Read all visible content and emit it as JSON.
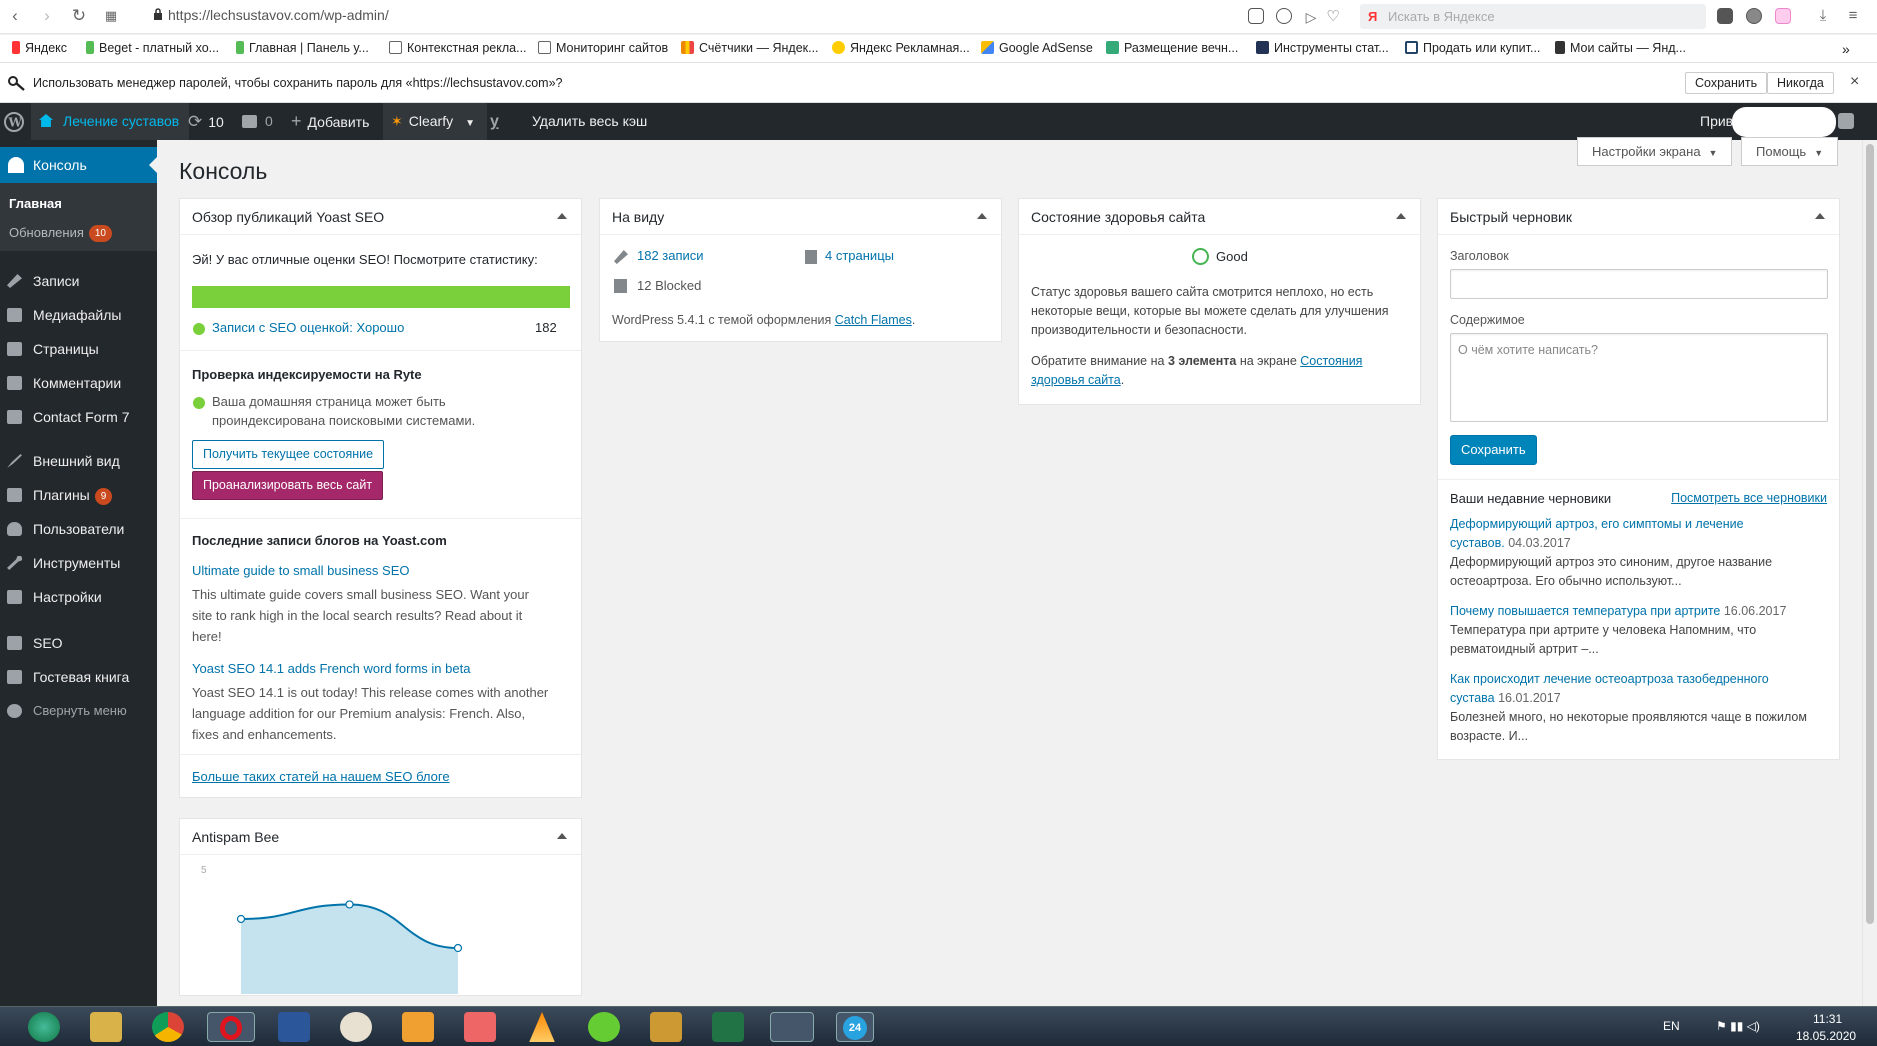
{
  "browser": {
    "url": "https://lechsustavov.com/wp-admin/",
    "search_placeholder": "Искать в Яндексе",
    "search_logo": "Я",
    "bookmarks": [
      {
        "label": "Яндекс",
        "color": "#f33"
      },
      {
        "label": "Beget - платный хо...",
        "color": "#5b5"
      },
      {
        "label": "Главная | Панель у...",
        "color": "#5b5"
      },
      {
        "label": "Контекстная рекла...",
        "color": "#888"
      },
      {
        "label": "Мониторинг сайтов",
        "color": "#888"
      },
      {
        "label": "Счётчики — Яндек...",
        "color": "#e80"
      },
      {
        "label": "Яндекс Рекламная...",
        "color": "#fc0"
      },
      {
        "label": "Google AdSense",
        "color": "#fbbc05"
      },
      {
        "label": "Размещение вечн...",
        "color": "#3a7"
      },
      {
        "label": "Инструменты стат...",
        "color": "#235"
      },
      {
        "label": "Продать или купит...",
        "color": "#246"
      },
      {
        "label": "Мои сайты — Янд...",
        "color": "#333"
      }
    ],
    "password_prompt": "Использовать менеджер паролей, чтобы сохранить пароль для «https://lechsustavov.com»?",
    "save_label": "Сохранить",
    "never_label": "Никогда",
    "close_glyph": "×"
  },
  "adminbar": {
    "site_name": "Лечение суставов",
    "updates_count": "10",
    "comments_count": "0",
    "add_label": "Добавить",
    "clearfy_label": "Clearfy",
    "clear_cache_label": "Удалить весь кэш",
    "greeting": "Прив"
  },
  "sidebar": {
    "console": "Консоль",
    "home": "Главная",
    "updates": "Обновления",
    "updates_badge": "10",
    "items": [
      {
        "label": "Записи"
      },
      {
        "label": "Медиафайлы"
      },
      {
        "label": "Страницы"
      },
      {
        "label": "Комментарии"
      },
      {
        "label": "Contact Form 7"
      },
      {
        "label": "Внешний вид"
      },
      {
        "label": "Плагины",
        "badge": "9"
      },
      {
        "label": "Пользователи"
      },
      {
        "label": "Инструменты"
      },
      {
        "label": "Настройки"
      },
      {
        "label": "SEO"
      },
      {
        "label": "Гостевая книга"
      },
      {
        "label": "Свернуть меню"
      }
    ]
  },
  "main": {
    "title": "Консоль",
    "screen_options": "Настройки экрана",
    "help": "Помощь"
  },
  "yoast": {
    "title": "Обзор публикаций Yoast SEO",
    "intro": "Эй! У вас отличные оценки SEO! Посмотрите статистику:",
    "good_fraction": 1.0,
    "good_color": "#7ad03a",
    "posts_label": "Записи с SEO оценкой:",
    "posts_rating": "Хорошо",
    "posts_count": "182",
    "ryte_title": "Проверка индексируемости на Ryte",
    "ryte_line1": "Ваша домашняя страница может быть",
    "ryte_line2": "проиндексирована поисковыми системами.",
    "btn_status": "Получить текущее состояние",
    "btn_analyze": "Проанализировать весь сайт",
    "blog_title": "Последние записи блогов на Yoast.com",
    "post1_title": "Ultimate guide to small business SEO",
    "post1_l1": "This ultimate guide covers small business SEO. Want your",
    "post1_l2": "site to rank high in the local search results? Read about it",
    "post1_l3": "here!",
    "post2_title": "Yoast SEO 14.1 adds French word forms in beta",
    "post2_l1": "Yoast SEO 14.1 is out today! This release comes with another",
    "post2_l2": "language addition for our Premium analysis: French. Also,",
    "post2_l3": "fixes and enhancements.",
    "more_link": "Больше таких статей на нашем SEO блоге"
  },
  "glance": {
    "title": "На виду",
    "posts": "182 записи",
    "pages": "4 страницы",
    "blocked": "12 Blocked",
    "wp_text": "WordPress 5.4.1 с темой оформления",
    "theme": "Catch Flames",
    "period": "."
  },
  "health": {
    "title": "Состояние здоровья сайта",
    "status": "Good",
    "text_l1": "Статус здоровья вашего сайта смотрится неплохо, но есть",
    "text_l2": "некоторые вещи, которые вы можете сделать для улучшения",
    "text_l3": "производительности и безопасности.",
    "note_pre": "Обратите внимание на",
    "note_bold": "3 элемента",
    "note_mid": "на экране",
    "note_link1": "Состояния",
    "note_link2": "здоровья сайта",
    "period": "."
  },
  "draft": {
    "title": "Быстрый черновик",
    "title_label": "Заголовок",
    "content_label": "Содержимое",
    "content_placeholder": "О чём хотите написать?",
    "save": "Сохранить",
    "recent_title": "Ваши недавние черновики",
    "view_all": "Посмотреть все черновики",
    "d1_title_l1": "Деформирующий артроз, его симптомы и лечение",
    "d1_title_l2": "суставов.",
    "d1_date": "04.03.2017",
    "d1_text_l1": "Деформирующий артроз это синоним, другое название",
    "d1_text_l2": "остеоартроза. Его обычно используют...",
    "d2_title": "Почему повышается температура при артрите",
    "d2_date": "16.06.2017",
    "d2_text_l1": "Температура при артрите у человека Напомним, что",
    "d2_text_l2": "ревматоидный артрит –...",
    "d3_title_l1": "Как происходит лечение остеоартроза тазобедренного",
    "d3_title_l2": "сустава",
    "d3_date": "16.01.2017",
    "d3_text_l1": "Болезней много, но некоторые проявляются чаще в пожилом",
    "d3_text_l2": "возрасте. И..."
  },
  "antispam": {
    "title": "Antispam Bee",
    "y_tick": "5"
  },
  "chart_data": {
    "type": "area",
    "x": [
      1,
      2,
      3
    ],
    "values": [
      3.1,
      3.7,
      1.9
    ],
    "ylim": [
      0,
      5
    ],
    "color": "#0073aa",
    "fill": "#c5e3ef"
  },
  "taskbar": {
    "lang": "EN",
    "time": "11:31",
    "date": "18.05.2020",
    "icons": [
      "start-icon",
      "explorer-icon",
      "chrome-icon",
      "opera-icon",
      "word-icon",
      "eye-app-icon",
      "media-player-icon",
      "app-icon",
      "vlc-icon",
      "utorrent-icon",
      "book-icon",
      "excel-icon",
      "computer-icon",
      "clock-24-icon"
    ]
  }
}
